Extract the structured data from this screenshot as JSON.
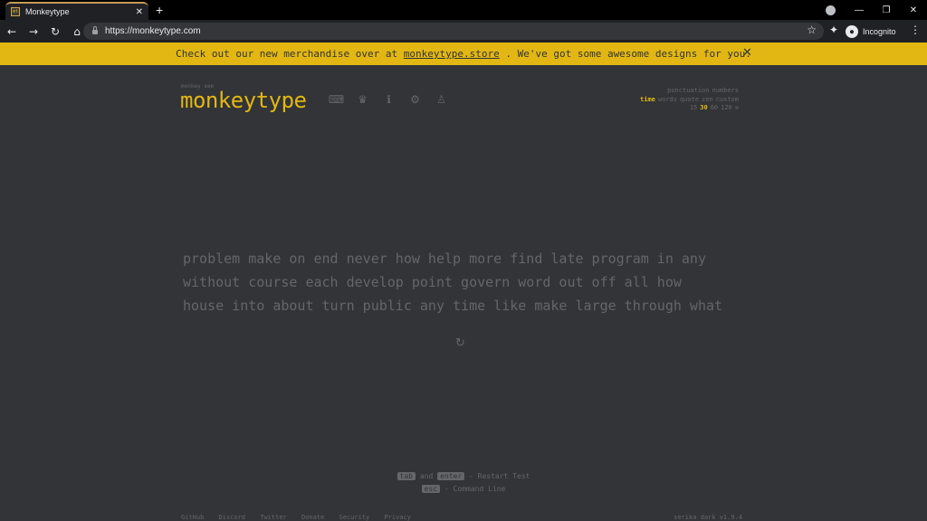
{
  "browser": {
    "tab_title": "Monkeytype",
    "favicon_text": "mt",
    "new_tab": "+",
    "url": "https://monkeytype.com",
    "profile_label": "Incognito"
  },
  "banner": {
    "text_before": "Check out our new merchandise over at ",
    "link": "monkeytype.store",
    "text_after": " . We've got some awesome designs for you.",
    "close": "✕"
  },
  "header": {
    "logo_top": "monkey see",
    "logo": "monkeytype",
    "nav_icons": [
      "keyboard-icon",
      "crown-icon",
      "info-icon",
      "gear-icon",
      "user-icon"
    ]
  },
  "config": {
    "row1": [
      "punctuation",
      "numbers"
    ],
    "row2": [
      "time",
      "words",
      "quote",
      "zen",
      "custom"
    ],
    "row3": [
      "15",
      "30",
      "60",
      "120"
    ],
    "active_mode": "time",
    "active_time": "30"
  },
  "words": [
    "problem make on end never how help more find late program in any",
    "without course each develop point govern word out off all how",
    "house into about turn public any time like make large through what"
  ],
  "hints": {
    "key1": "tab",
    "and": "and",
    "key2": "enter",
    "restart": "- Restart Test",
    "key3": "esc",
    "command": "- Command Line"
  },
  "footer": {
    "links": [
      "GitHub",
      "Discord",
      "Twitter",
      "Donate",
      "Security",
      "Privacy"
    ],
    "theme": "serika dark",
    "version": "v1.9.4"
  },
  "colors": {
    "bg": "#323437",
    "main": "#e2b714",
    "sub": "#646669"
  }
}
